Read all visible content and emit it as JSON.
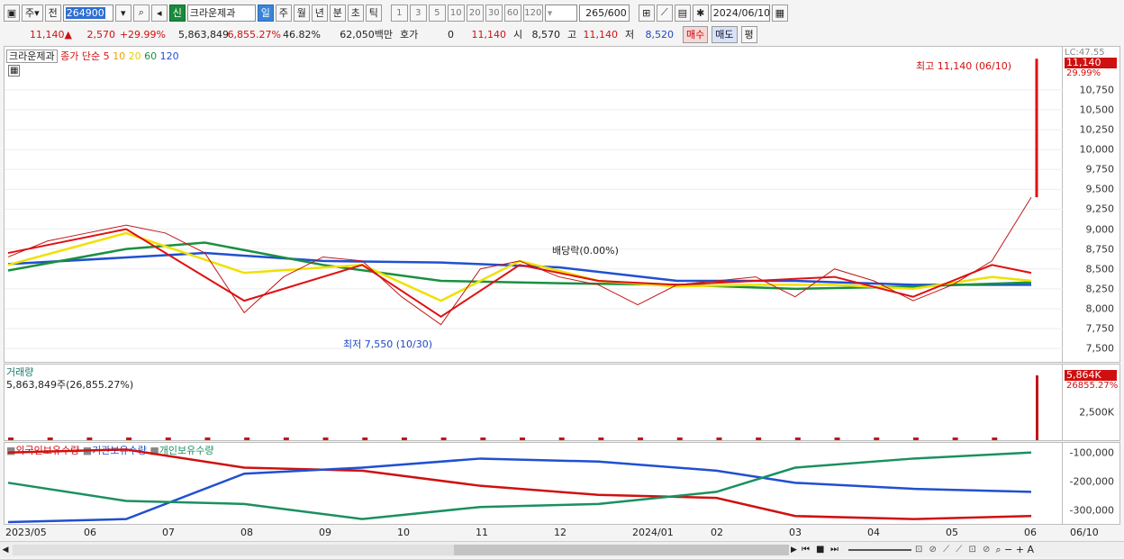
{
  "toolbar": {
    "type_label": "주",
    "prev_label": "전",
    "stock_code": "264900",
    "new_badge": "신",
    "stock_name": "크라운제과",
    "periods": [
      "일",
      "주",
      "월",
      "년",
      "분",
      "초",
      "틱"
    ],
    "active_period": "일",
    "intervals": [
      "1",
      "3",
      "5",
      "10",
      "20",
      "30",
      "60",
      "120"
    ],
    "count": "265",
    "count_max": "/600",
    "date": "2024/06/10"
  },
  "quote": {
    "price": "11,140",
    "change": "2,570",
    "change_pct": "+29.99%",
    "volume": "5,863,849",
    "volume_pct": "6,855.27%",
    "turnover_pct": "46.82%",
    "amount": "62,050백만",
    "hoga_label": "호가",
    "hoga_value": "0",
    "hoga_price": "11,140",
    "open_label": "시",
    "open": "8,570",
    "high_label": "고",
    "high": "11,140",
    "low_label": "저",
    "low": "8,520",
    "buy_label": "매수",
    "sell_label": "매도",
    "avg_label": "평"
  },
  "price_panel": {
    "title": "크라운제과",
    "legend_prefix": "종가 단순",
    "ma_periods": [
      "5",
      "10",
      "20",
      "60",
      "120"
    ],
    "ma_colors": [
      "#e01010",
      "#f0a000",
      "#f0e000",
      "#1a9040",
      "#2050d0"
    ],
    "y_ticks": [
      "10,750",
      "10,500",
      "10,250",
      "10,000",
      "9,750",
      "9,500",
      "9,250",
      "9,000",
      "8,750",
      "8,500",
      "8,250",
      "8,000",
      "7,750",
      "7,500"
    ],
    "axis_top_label": "LC:47.55",
    "price_tag": "11,140",
    "pct_tag": "29.99%",
    "high_annotation": "최고 11,140 (06/10)",
    "low_annotation": "최저 7,550 (10/30)",
    "dividend_annotation": "배당락(0.00%)"
  },
  "volume_panel": {
    "title": "거래량",
    "value_text": "5,863,849주(26,855.27%)",
    "tag_value": "5,864K",
    "tag_pct": "26855.27%",
    "y_ticks": [
      "2,500K"
    ]
  },
  "holding_panel": {
    "series": [
      "외국인보유수량",
      "기관보유수량",
      "개인보유수량"
    ],
    "series_colors": [
      "#d01010",
      "#2050d0",
      "#1a9060"
    ],
    "y_ticks": [
      "-100,000",
      "-200,000",
      "-300,000"
    ]
  },
  "x_axis": {
    "labels": [
      "2023/05",
      "06",
      "07",
      "08",
      "09",
      "10",
      "11",
      "12",
      "2024/01",
      "02",
      "03",
      "04",
      "05",
      "06"
    ],
    "right_label": "06/10"
  },
  "chart_data": {
    "type": "line",
    "price_series": {
      "name": "종가",
      "points": [
        [
          0,
          8650
        ],
        [
          1,
          8850
        ],
        [
          2,
          8950
        ],
        [
          3,
          9050
        ],
        [
          4,
          8950
        ],
        [
          5,
          8700
        ],
        [
          6,
          7950
        ],
        [
          7,
          8400
        ],
        [
          8,
          8650
        ],
        [
          9,
          8600
        ],
        [
          10,
          8150
        ],
        [
          11,
          7800
        ],
        [
          12,
          8500
        ],
        [
          13,
          8600
        ],
        [
          14,
          8400
        ],
        [
          15,
          8300
        ],
        [
          16,
          8050
        ],
        [
          17,
          8300
        ],
        [
          18,
          8350
        ],
        [
          19,
          8400
        ],
        [
          20,
          8150
        ],
        [
          21,
          8500
        ],
        [
          22,
          8350
        ],
        [
          23,
          8100
        ],
        [
          24,
          8300
        ],
        [
          25,
          8600
        ],
        [
          26,
          9400
        ]
      ]
    },
    "ma5": {
      "name": "5",
      "points": [
        [
          0,
          8700
        ],
        [
          3,
          9000
        ],
        [
          6,
          8100
        ],
        [
          9,
          8550
        ],
        [
          11,
          7900
        ],
        [
          13,
          8550
        ],
        [
          15,
          8350
        ],
        [
          17,
          8300
        ],
        [
          19,
          8350
        ],
        [
          21,
          8400
        ],
        [
          23,
          8150
        ],
        [
          25,
          8550
        ],
        [
          26,
          8450
        ]
      ]
    },
    "ma20": {
      "name": "20",
      "points": [
        [
          0,
          8550
        ],
        [
          3,
          8950
        ],
        [
          6,
          8450
        ],
        [
          9,
          8550
        ],
        [
          11,
          8100
        ],
        [
          13,
          8600
        ],
        [
          15,
          8350
        ],
        [
          17,
          8280
        ],
        [
          19,
          8300
        ],
        [
          21,
          8300
        ],
        [
          23,
          8250
        ],
        [
          25,
          8400
        ],
        [
          26,
          8350
        ]
      ]
    },
    "ma60": {
      "name": "60",
      "points": [
        [
          0,
          8480
        ],
        [
          3,
          8750
        ],
        [
          5,
          8830
        ],
        [
          8,
          8550
        ],
        [
          11,
          8350
        ],
        [
          14,
          8320
        ],
        [
          17,
          8300
        ],
        [
          20,
          8250
        ],
        [
          23,
          8280
        ],
        [
          26,
          8330
        ]
      ]
    },
    "ma120": {
      "name": "120",
      "points": [
        [
          0,
          8560
        ],
        [
          5,
          8700
        ],
        [
          8,
          8600
        ],
        [
          11,
          8580
        ],
        [
          14,
          8520
        ],
        [
          17,
          8350
        ],
        [
          20,
          8350
        ],
        [
          23,
          8300
        ],
        [
          26,
          8300
        ]
      ]
    },
    "high": 11140,
    "low": 7550,
    "volume_last": 5863849,
    "holdings": {
      "foreign": [
        [
          0,
          -100000
        ],
        [
          3,
          -90000
        ],
        [
          6,
          -150000
        ],
        [
          9,
          -160000
        ],
        [
          12,
          -210000
        ],
        [
          15,
          -240000
        ],
        [
          18,
          -250000
        ],
        [
          20,
          -310000
        ],
        [
          23,
          -320000
        ],
        [
          26,
          -310000
        ]
      ],
      "institution": [
        [
          0,
          -330000
        ],
        [
          3,
          -320000
        ],
        [
          6,
          -170000
        ],
        [
          9,
          -150000
        ],
        [
          12,
          -120000
        ],
        [
          15,
          -130000
        ],
        [
          18,
          -160000
        ],
        [
          20,
          -200000
        ],
        [
          23,
          -220000
        ],
        [
          26,
          -230000
        ]
      ],
      "individual": [
        [
          0,
          -200000
        ],
        [
          3,
          -260000
        ],
        [
          6,
          -270000
        ],
        [
          9,
          -320000
        ],
        [
          12,
          -280000
        ],
        [
          15,
          -270000
        ],
        [
          18,
          -230000
        ],
        [
          20,
          -150000
        ],
        [
          23,
          -120000
        ],
        [
          26,
          -100000
        ]
      ]
    },
    "ylim_price": [
      7400,
      11200
    ],
    "ylim_holdings": [
      -330000,
      -80000
    ]
  }
}
